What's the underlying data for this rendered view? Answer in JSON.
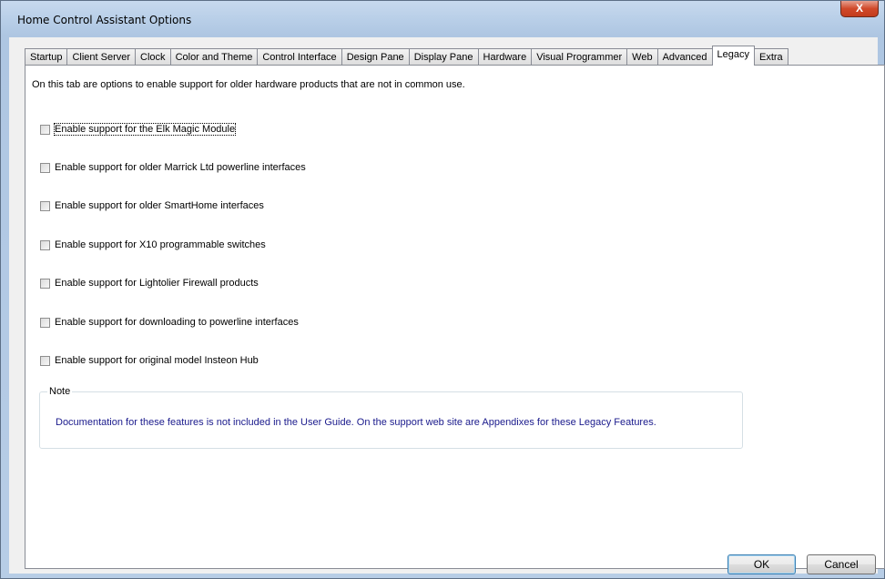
{
  "window": {
    "title": "Home Control Assistant Options",
    "close_label": "X"
  },
  "tabs": [
    {
      "label": "Startup"
    },
    {
      "label": "Client Server"
    },
    {
      "label": "Clock"
    },
    {
      "label": "Color and Theme"
    },
    {
      "label": "Control Interface"
    },
    {
      "label": "Design Pane"
    },
    {
      "label": "Display Pane"
    },
    {
      "label": "Hardware"
    },
    {
      "label": "Visual Programmer"
    },
    {
      "label": "Web"
    },
    {
      "label": "Advanced"
    },
    {
      "label": "Legacy",
      "active": true
    },
    {
      "label": "Extra"
    }
  ],
  "legacy": {
    "intro": "On this tab are options to enable support for older hardware products that are not in common use.",
    "options": [
      {
        "label": "Enable support for the Elk Magic Module",
        "checked": false
      },
      {
        "label": "Enable support for older Marrick Ltd powerline interfaces",
        "checked": false
      },
      {
        "label": "Enable support for older SmartHome interfaces",
        "checked": false
      },
      {
        "label": "Enable support for X10 programmable switches",
        "checked": false
      },
      {
        "label": "Enable support for Lightolier Firewall products",
        "checked": false
      },
      {
        "label": "Enable support for downloading to powerline interfaces",
        "checked": false
      },
      {
        "label": "Enable support for original model Insteon Hub",
        "checked": false
      }
    ],
    "note": {
      "title": "Note",
      "text": "Documentation for these features is not included in the User Guide.  On the support web site are Appendixes for these Legacy Features."
    }
  },
  "buttons": {
    "ok": "OK",
    "cancel": "Cancel"
  }
}
